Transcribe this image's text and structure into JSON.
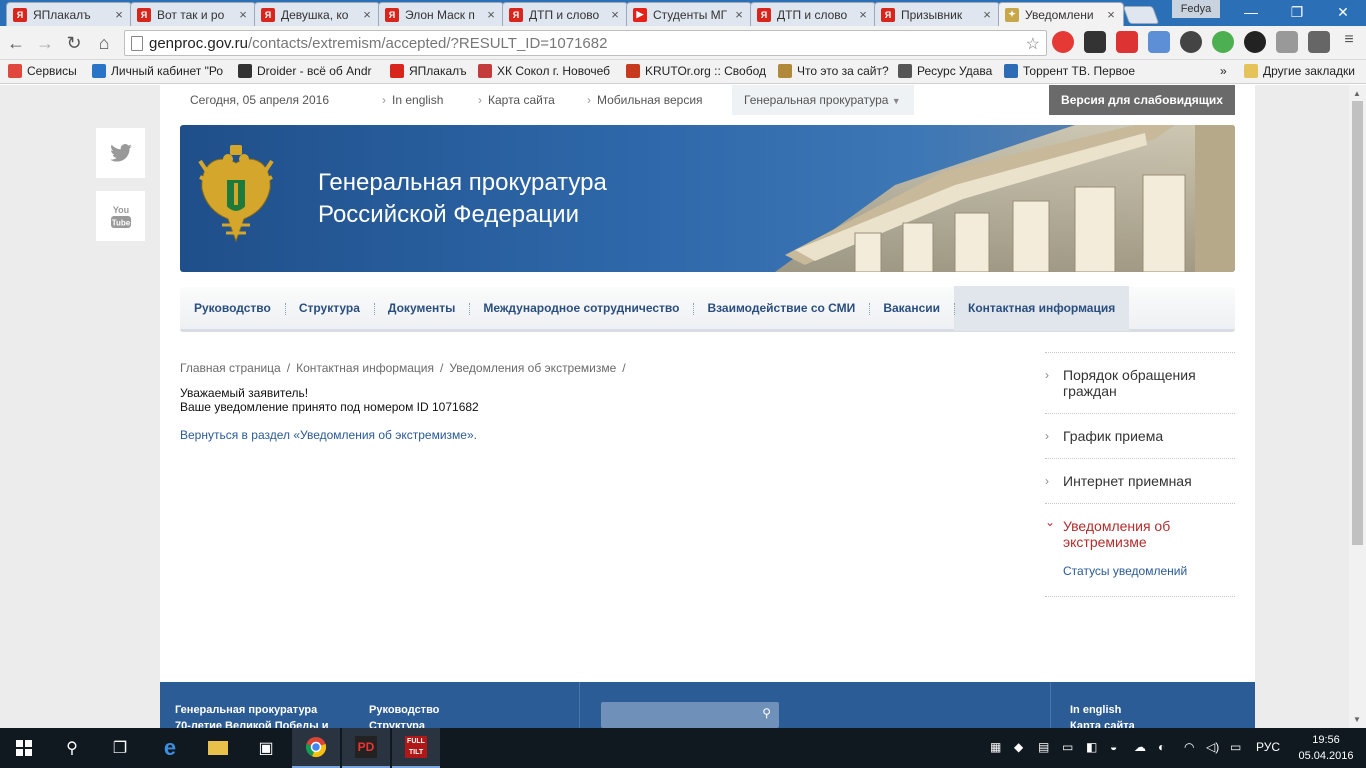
{
  "browser": {
    "tabs": [
      {
        "title": "ЯПлакалъ",
        "icon": "yaplakal-icon"
      },
      {
        "title": "Вот так и ро",
        "icon": "yaplakal-icon"
      },
      {
        "title": "Девушка, ко",
        "icon": "yaplakal-icon"
      },
      {
        "title": "Элон Маск п",
        "icon": "yaplakal-icon"
      },
      {
        "title": "ДТП и слово",
        "icon": "yaplakal-icon"
      },
      {
        "title": "Студенты МГ",
        "icon": "youtube-icon"
      },
      {
        "title": "ДТП и слово",
        "icon": "yaplakal-icon"
      },
      {
        "title": "Призывник",
        "icon": "yaplakal-icon"
      },
      {
        "title": "Уведомлени",
        "icon": "emblem-icon"
      }
    ],
    "profile_name": "Fedya",
    "url_host": "genproc.gov.ru",
    "url_path": "/contacts/extremism/accepted/?RESULT_ID=1071682",
    "bookmarks": [
      {
        "label": "Сервисы",
        "color": "#e0483e"
      },
      {
        "label": "Личный кабинет \"Ро",
        "color": "#2a74c8"
      },
      {
        "label": "Droider - всё об Andr",
        "color": "#333333"
      },
      {
        "label": "ЯПлакалъ",
        "color": "#d8261c"
      },
      {
        "label": "ХК Сокол г. Новочеб",
        "color": "#c43b3b"
      },
      {
        "label": "KRUTOr.org :: Свобод",
        "color": "#c83a20"
      },
      {
        "label": "Что это за сайт?",
        "color": "#b08a3a"
      },
      {
        "label": "Ресурс Удава",
        "color": "#555555"
      },
      {
        "label": "Торрент ТВ. Первое",
        "color": "#2c6db5"
      }
    ],
    "bookmarks_more": "»",
    "other_bookmarks": "Другие закладки"
  },
  "site": {
    "topbar": {
      "date": "Сегодня, 05 апреля 2016",
      "in_english": "In english",
      "sitemap": "Карта сайта",
      "mobile": "Мобильная версия",
      "dropdown": "Генеральная прокуратура",
      "accessible": "Версия для слабовидящих"
    },
    "banner_title_line1": "Генеральная прокуратура",
    "banner_title_line2": "Российской Федерации",
    "nav": [
      "Руководство",
      "Структура",
      "Документы",
      "Международное сотрудничество",
      "Взаимодействие со СМИ",
      "Вакансии",
      "Контактная информация"
    ],
    "breadcrumb": [
      "Главная страница",
      "Контактная информация",
      "Уведомления об экстремизме"
    ],
    "message_line1": "Уважаемый заявитель!",
    "message_line2": "Ваше уведомление принято под номером ID 1071682",
    "back_link": "Вернуться в раздел «Уведомления об экстремизме».",
    "sidemenu": [
      "Порядок обращения граждан",
      "График приема",
      "Интернет приемная",
      "Уведомления об экстремизме"
    ],
    "sidemenu_sub": "Статусы уведомлений",
    "footer": {
      "col1": [
        "Генеральная прокуратура",
        "70-летие Великой Победы и"
      ],
      "col2": [
        "Руководство",
        "Структура"
      ],
      "col3": [
        "In english",
        "Карта сайта"
      ]
    }
  },
  "taskbar": {
    "lang": "РУС",
    "time": "19:56",
    "date": "05.04.2016"
  },
  "colors": {
    "tabstrip": "#2b6fb7",
    "banner": "#2f69ab",
    "nav_text": "#2a4f7f",
    "link": "#2a5a96",
    "current_section": "#b32d2d",
    "footer": "#2c5c95"
  }
}
